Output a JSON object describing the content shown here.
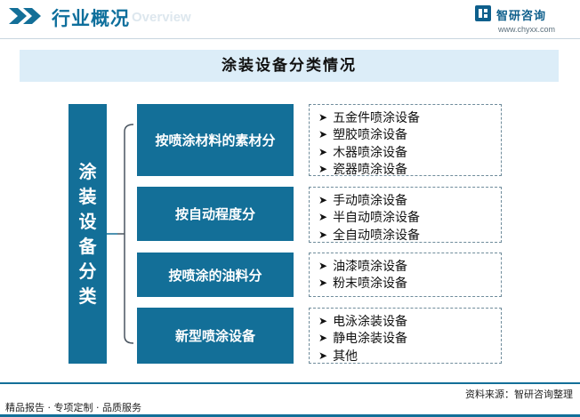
{
  "header": {
    "title": "行业概况",
    "overview": "Overview",
    "brand_name": "智研咨询",
    "brand_url": "www.chyxx.com",
    "accent_color": "#136f98"
  },
  "diagram": {
    "title": "涂装设备分类情况",
    "root": "涂装设备分类",
    "categories": [
      {
        "label": "按喷涂材料的素材分",
        "items": [
          "五金件喷涂设备",
          "塑胶喷涂设备",
          "木器喷涂设备",
          "瓷器喷涂设备"
        ]
      },
      {
        "label": "按自动程度分",
        "items": [
          "手动喷涂设备",
          "半自动喷涂设备",
          "全自动喷涂设备"
        ]
      },
      {
        "label": "按喷涂的油料分",
        "items": [
          "油漆喷涂设备",
          "粉末喷涂设备"
        ]
      },
      {
        "label": "新型喷涂设备",
        "items": [
          "电泳涂装设备",
          "静电涂装设备",
          "其他"
        ]
      }
    ],
    "bullet_icon": "arrow-bullet-icon"
  },
  "footer": {
    "left": "精品报告 · 专项定制 · 品质服务",
    "source": "资料来源：智研咨询整理"
  }
}
